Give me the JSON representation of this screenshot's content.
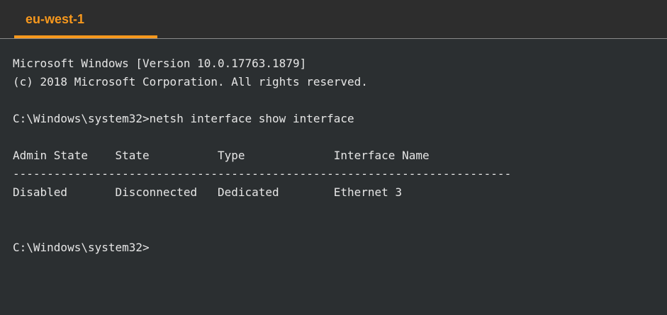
{
  "tab": {
    "label": "eu-west-1"
  },
  "colors": {
    "accent": "#f7981d",
    "background": "#2b2f31",
    "text": "#e6e6e6"
  },
  "terminal": {
    "lines": [
      "Microsoft Windows [Version 10.0.17763.1879]",
      "(c) 2018 Microsoft Corporation. All rights reserved.",
      "",
      "C:\\Windows\\system32>netsh interface show interface",
      "",
      "Admin State    State          Type             Interface Name",
      "-------------------------------------------------------------------------",
      "Disabled       Disconnected   Dedicated        Ethernet 3",
      "",
      "",
      "C:\\Windows\\system32>"
    ]
  }
}
